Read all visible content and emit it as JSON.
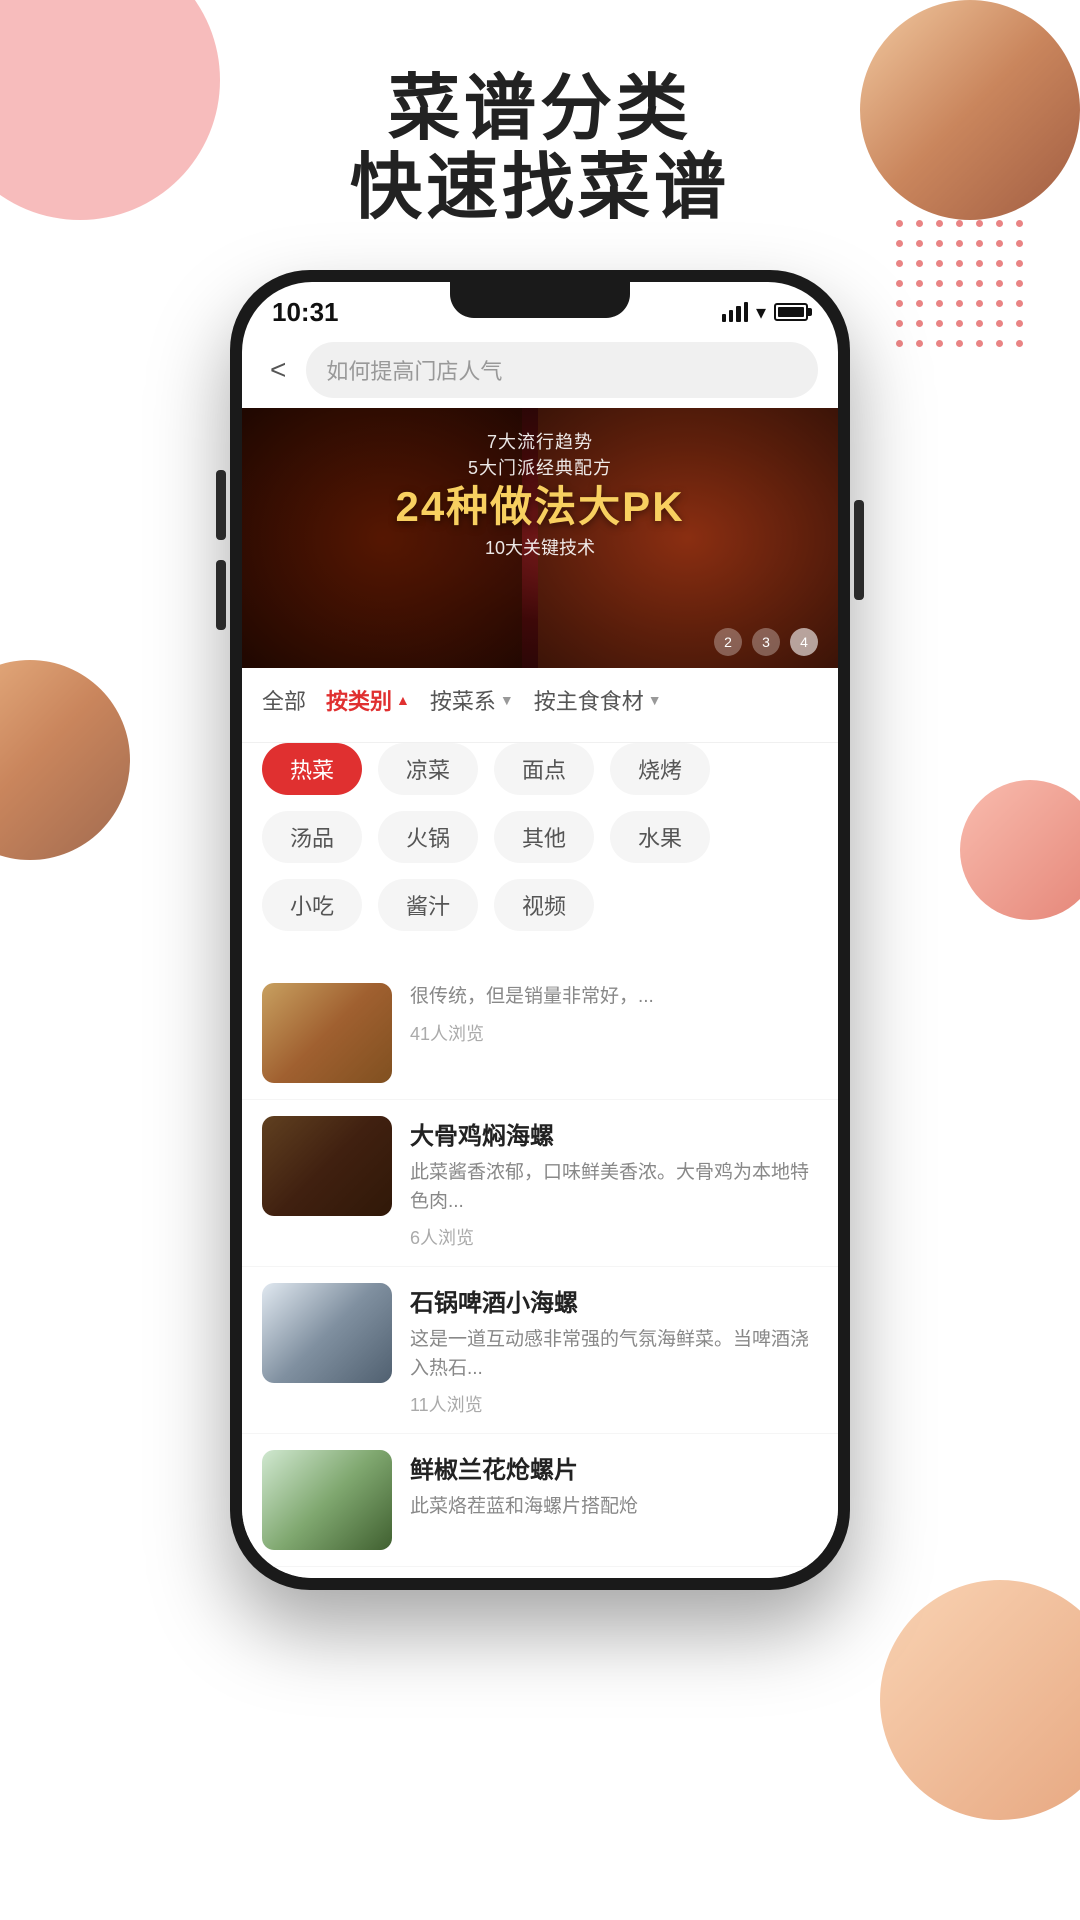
{
  "page": {
    "background": "#ffffff"
  },
  "header": {
    "title_line1": "菜谱分类",
    "title_line2": "快速找菜谱"
  },
  "status_bar": {
    "time": "10:31",
    "signal_label": "signal",
    "wifi_label": "wifi",
    "battery_label": "battery"
  },
  "search": {
    "placeholder": "如何提高门店人气",
    "back_label": "<"
  },
  "banner": {
    "line1": "7大流行趋势",
    "line2": "5大门派经典配方",
    "main": "24种做法大PK",
    "line3": "10大关键技术",
    "dots": [
      "2",
      "3",
      "4"
    ]
  },
  "filter": {
    "all_label": "全部",
    "by_category_label": "按类别",
    "by_cuisine_label": "按菜系",
    "by_ingredient_label": "按主食食材"
  },
  "categories": [
    {
      "id": "hot",
      "label": "热菜",
      "selected": true
    },
    {
      "id": "cold",
      "label": "凉菜",
      "selected": false
    },
    {
      "id": "dim",
      "label": "面点",
      "selected": false
    },
    {
      "id": "bbq",
      "label": "烧烤",
      "selected": false
    },
    {
      "id": "soup",
      "label": "汤品",
      "selected": false
    },
    {
      "id": "hotpot",
      "label": "火锅",
      "selected": false
    },
    {
      "id": "other",
      "label": "其他",
      "selected": false
    },
    {
      "id": "fruit",
      "label": "水果",
      "selected": false
    },
    {
      "id": "snack",
      "label": "小吃",
      "selected": false
    },
    {
      "id": "sauce",
      "label": "酱汁",
      "selected": false
    },
    {
      "id": "video",
      "label": "视频",
      "selected": false
    }
  ],
  "recipes": [
    {
      "id": 1,
      "title": "",
      "desc": "很传统，但是销量非常好，...",
      "views": "41人浏览",
      "img_class": "recipe-img-1"
    },
    {
      "id": 2,
      "title": "大骨鸡焖海螺",
      "desc": "此菜酱香浓郁，口味鲜美香浓。大骨鸡为本地特色肉...",
      "views": "6人浏览",
      "img_class": "recipe-img-2"
    },
    {
      "id": 3,
      "title": "石锅啤酒小海螺",
      "desc": "这是一道互动感非常强的气氛海鲜菜。当啤酒浇入热石...",
      "views": "11人浏览",
      "img_class": "recipe-img-3"
    },
    {
      "id": 4,
      "title": "鲜椒兰花炝螺片",
      "desc": "此菜烙茬蓝和海螺片搭配炝",
      "views": "",
      "img_class": "recipe-img-4"
    }
  ]
}
